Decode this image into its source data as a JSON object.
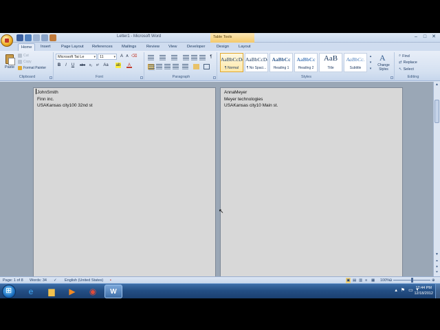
{
  "window": {
    "title": "Letter1 - Microsoft Word",
    "context_tab_title": "Table Tools"
  },
  "tabs": [
    "Home",
    "Insert",
    "Page Layout",
    "References",
    "Mailings",
    "Review",
    "View",
    "Developer",
    "Design",
    "Layout"
  ],
  "active_tab": "Home",
  "clipboard": {
    "paste_label": "Paste",
    "cut_label": "Cut",
    "copy_label": "Copy",
    "format_painter_label": "Format Painter",
    "group_label": "Clipboard"
  },
  "font": {
    "font_name": "Microsoft Tai Le",
    "font_size": "11",
    "group_label": "Font"
  },
  "paragraph": {
    "group_label": "Paragraph"
  },
  "styles": {
    "group_label": "Styles",
    "items": [
      {
        "sample": "AaBbCcDc",
        "name": "¶ Normal"
      },
      {
        "sample": "AaBbCcDc",
        "name": "¶ No Spaci..."
      },
      {
        "sample": "AaBbCc",
        "name": "Heading 1"
      },
      {
        "sample": "AaBbCc",
        "name": "Heading 2"
      },
      {
        "sample": "AaB",
        "name": "Title"
      },
      {
        "sample": "AaBbCc.",
        "name": "Subtitle"
      }
    ],
    "change_styles_label": "Change Styles"
  },
  "editing": {
    "group_label": "Editing",
    "find_label": "Find",
    "replace_label": "Replace",
    "select_label": "Select"
  },
  "document": {
    "left_page_lines": [
      "JohnSmith",
      "Finn inc.",
      "USAKansas city100 32nd st"
    ],
    "right_page_lines": [
      "AnnaMeyer",
      "Meyer technologies",
      "USAKansas city10 Main st."
    ]
  },
  "statusbar": {
    "page": "Page: 1 of 8",
    "words": "Words: 34",
    "language": "English (United States)",
    "zoom": "100%"
  },
  "taskbar": {
    "time": "12:44 PM",
    "date": "12/18/2012"
  },
  "colors": {
    "accent": "#2b579a",
    "ribbon": "#d5e1f1",
    "page": "#d8d8d8",
    "taskbar": "#244f85"
  }
}
